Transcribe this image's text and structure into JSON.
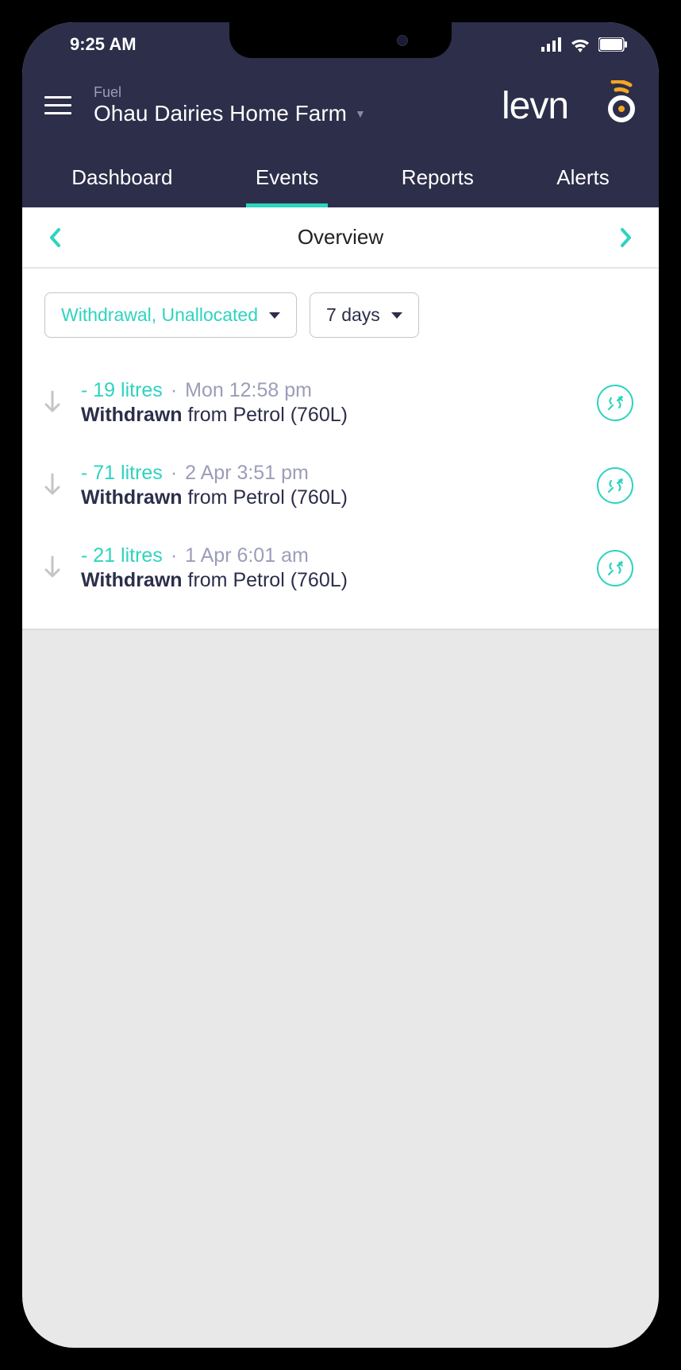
{
  "status": {
    "time": "9:25 AM"
  },
  "header": {
    "subtitle": "Fuel",
    "title": "Ohau Dairies Home Farm",
    "logo_text": "levno"
  },
  "tabs": {
    "dashboard": "Dashboard",
    "events": "Events",
    "reports": "Reports",
    "alerts": "Alerts"
  },
  "overview": {
    "title": "Overview"
  },
  "filters": {
    "type": "Withdrawal, Unallocated",
    "range": "7 days"
  },
  "events": [
    {
      "amount": "- 19 litres",
      "time": "Mon 12:58 pm",
      "action": "Withdrawn",
      "detail": " from Petrol (760L)"
    },
    {
      "amount": "- 71 litres",
      "time": "2 Apr 3:51 pm",
      "action": "Withdrawn",
      "detail": " from Petrol (760L)"
    },
    {
      "amount": "- 21 litres",
      "time": "1 Apr 6:01 am",
      "action": "Withdrawn",
      "detail": " from Petrol (760L)"
    }
  ]
}
